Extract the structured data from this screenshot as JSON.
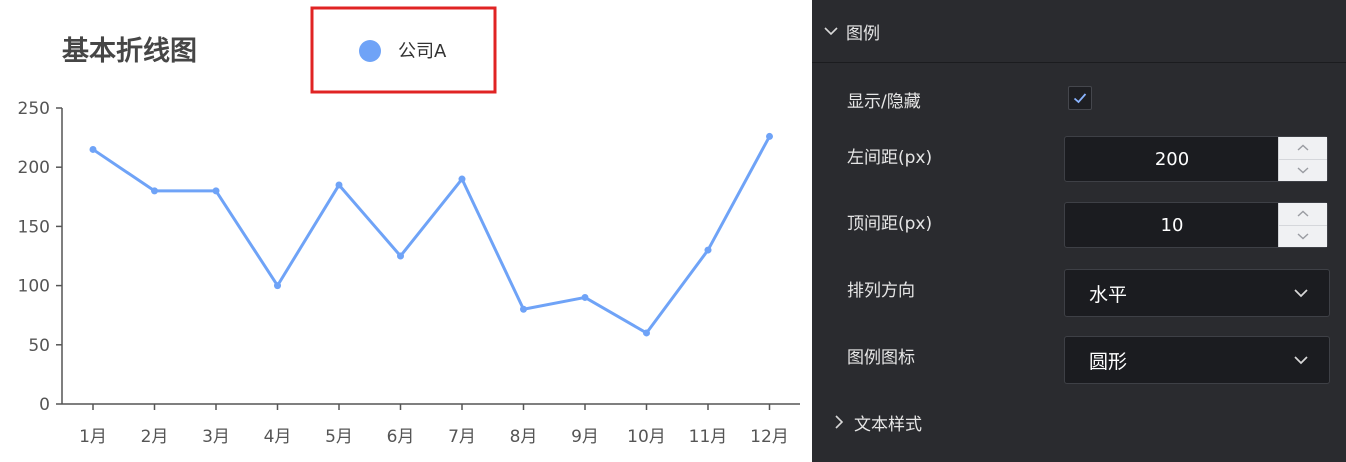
{
  "chart_data": {
    "type": "line",
    "title": "基本折线图",
    "categories": [
      "1月",
      "2月",
      "3月",
      "4月",
      "5月",
      "6月",
      "7月",
      "8月",
      "9月",
      "10月",
      "11月",
      "12月"
    ],
    "series": [
      {
        "name": "公司A",
        "values": [
          215,
          180,
          180,
          100,
          185,
          125,
          190,
          80,
          90,
          60,
          130,
          226
        ],
        "color": "#6fa3f7"
      }
    ],
    "yticks": [
      0,
      50,
      100,
      150,
      200,
      250
    ],
    "ylim": [
      0,
      250
    ],
    "grid": false,
    "legend_marker": "circle",
    "legend_highlight_color": "#e02424"
  },
  "panel": {
    "legend_section": {
      "title": "图例",
      "expanded": true
    },
    "show_hide": {
      "label": "显示/隐藏",
      "checked": true
    },
    "left_margin": {
      "label": "左间距(px)",
      "value": "200"
    },
    "top_margin": {
      "label": "顶间距(px)",
      "value": "10"
    },
    "orientation": {
      "label": "排列方向",
      "value": "水平"
    },
    "legend_icon": {
      "label": "图例图标",
      "value": "圆形"
    },
    "text_style_section": {
      "title": "文本样式",
      "expanded": false
    }
  }
}
